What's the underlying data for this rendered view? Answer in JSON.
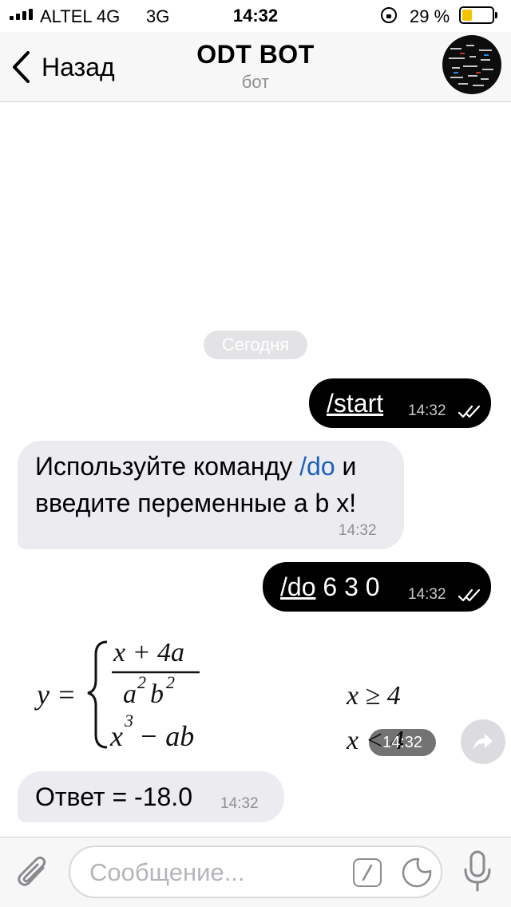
{
  "status_bar": {
    "carrier": "ALTEL 4G",
    "network": "3G",
    "time": "14:32",
    "battery": "29 %",
    "battery_color": "#f5c400"
  },
  "header": {
    "back_label": "Назад",
    "title": "ODT BOT",
    "subtitle": "бот"
  },
  "chat": {
    "date_label": "Сегодня",
    "messages": [
      {
        "direction": "out",
        "command": "/start",
        "time": "14:32",
        "status_icon": "double-check-icon"
      },
      {
        "direction": "in",
        "text_before": "Используйте команду ",
        "link": "/do",
        "text_after": " и",
        "line2": "введите переменные a b x!",
        "time": "14:32"
      },
      {
        "direction": "out",
        "command": "/do",
        "text": " 6 3 0",
        "time": "14:32",
        "status_icon": "double-check-icon"
      },
      {
        "direction": "in",
        "type": "image",
        "time": "14:32",
        "formula": {
          "lhs": "y =",
          "num": "x + 4a",
          "den_a": "a",
          "den_a_exp": "2",
          "den_b": "b",
          "den_b_exp": "2",
          "row2_base": "x",
          "row2_exp": "3",
          "row2_rest": " − ab",
          "cond1": "x ≥ 4",
          "cond2": "x < 4"
        }
      },
      {
        "direction": "in",
        "text": "Ответ = -18.0",
        "time": "14:32"
      }
    ]
  },
  "input": {
    "placeholder": "Сообщение..."
  },
  "colors": {
    "outgoing_bubble": "#000000",
    "incoming_bubble": "#ececf0",
    "link": "#1d5fbd"
  }
}
